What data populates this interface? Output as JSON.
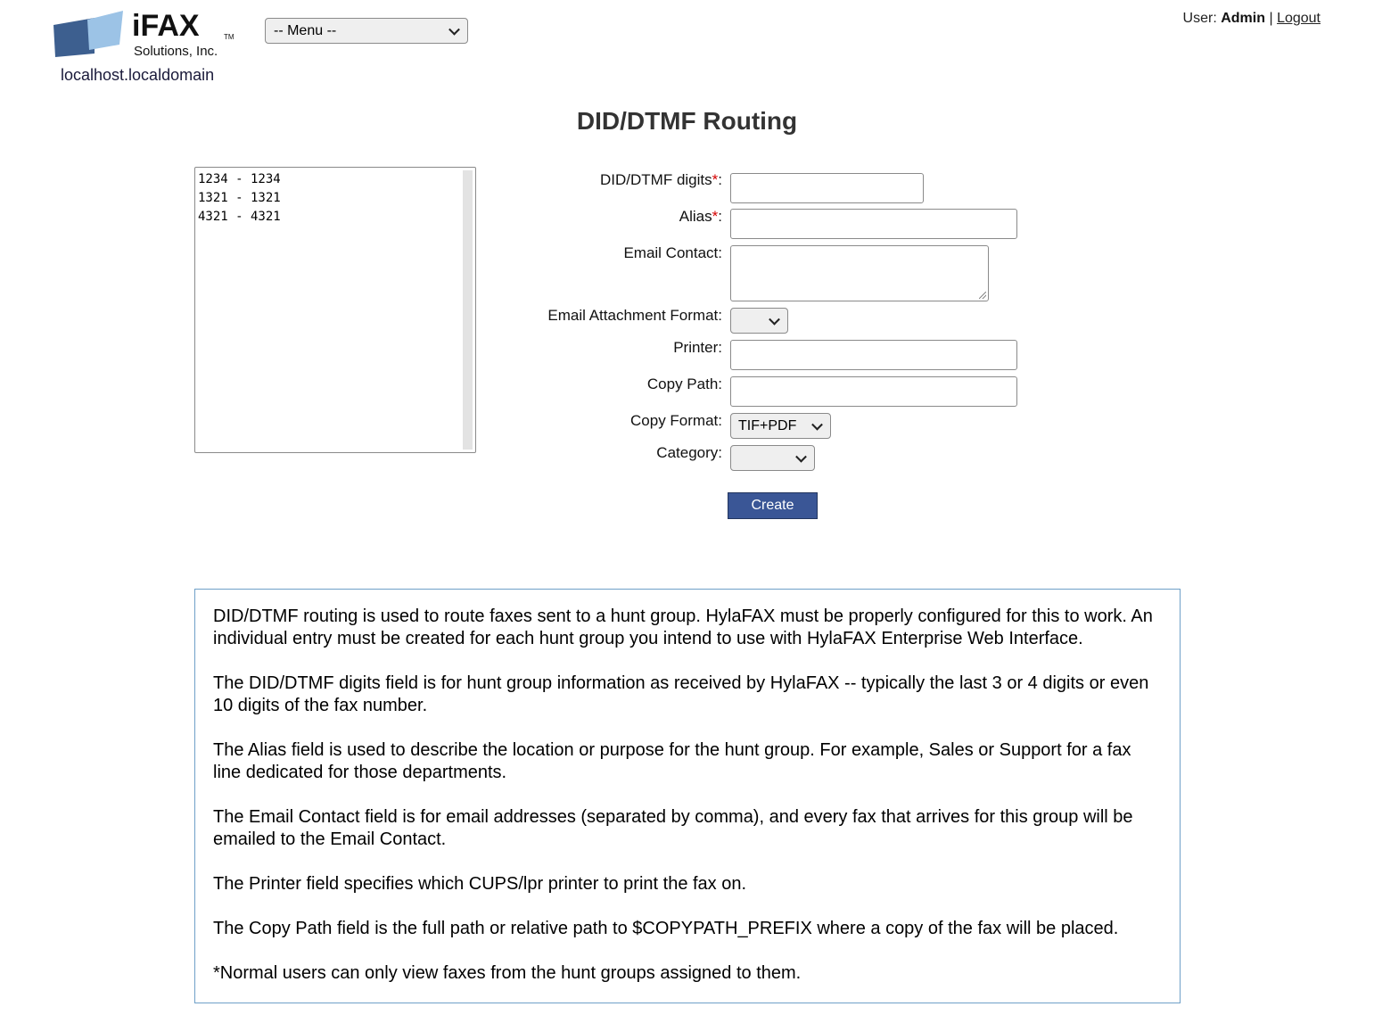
{
  "header": {
    "logo": {
      "brand": "iFAX",
      "tm": "TM",
      "sub": "Solutions, Inc."
    },
    "hostname": "localhost.localdomain",
    "menu_select_value": "-- Menu --",
    "user_label": "User:",
    "user_name": "Admin",
    "separator": "|",
    "logout_label": "Logout"
  },
  "page_title": "DID/DTMF Routing",
  "route_list": [
    "1234 - 1234",
    "1321 - 1321",
    "4321 - 4321"
  ],
  "form": {
    "did_label": "DID/DTMF digits",
    "alias_label": "Alias",
    "email_label": "Email Contact:",
    "attach_format_label": "Email Attachment Format:",
    "attach_format_value": "",
    "printer_label": "Printer:",
    "copy_path_label": "Copy Path:",
    "copy_format_label": "Copy Format:",
    "copy_format_value": "TIF+PDF",
    "category_label": "Category:",
    "category_value": "",
    "required_mark": "*",
    "colon": ":",
    "create_label": "Create",
    "did_value": "",
    "alias_value": "",
    "email_value": "",
    "printer_value": "",
    "copy_path_value": ""
  },
  "info": [
    "DID/DTMF routing is used to route faxes sent to a hunt group. HylaFAX must be properly configured for this to work. An individual entry must be created for each hunt group you intend to use with HylaFAX Enterprise Web Interface.",
    "The DID/DTMF digits field is for hunt group information as received by HylaFAX -- typically the last 3 or 4 digits or even 10 digits of the fax number.",
    "The Alias field is used to describe the location or purpose for the hunt group. For example, Sales or Support for a fax line dedicated for those departments.",
    "The Email Contact field is for email addresses (separated by comma), and every fax that arrives for this group will be emailed to the Email Contact.",
    "The Printer field specifies which CUPS/lpr printer to print the fax on.",
    "The Copy Path field is the full path or relative path to $COPYPATH_PREFIX where a copy of the fax will be placed.",
    "*Normal users can only view faxes from the hunt groups assigned to them."
  ],
  "colors": {
    "button_bg": "#3a5696",
    "info_border": "#6fa0c8",
    "required": "#d40000",
    "logo_dark": "#3d5f8f",
    "logo_light": "#9cc3e6"
  }
}
